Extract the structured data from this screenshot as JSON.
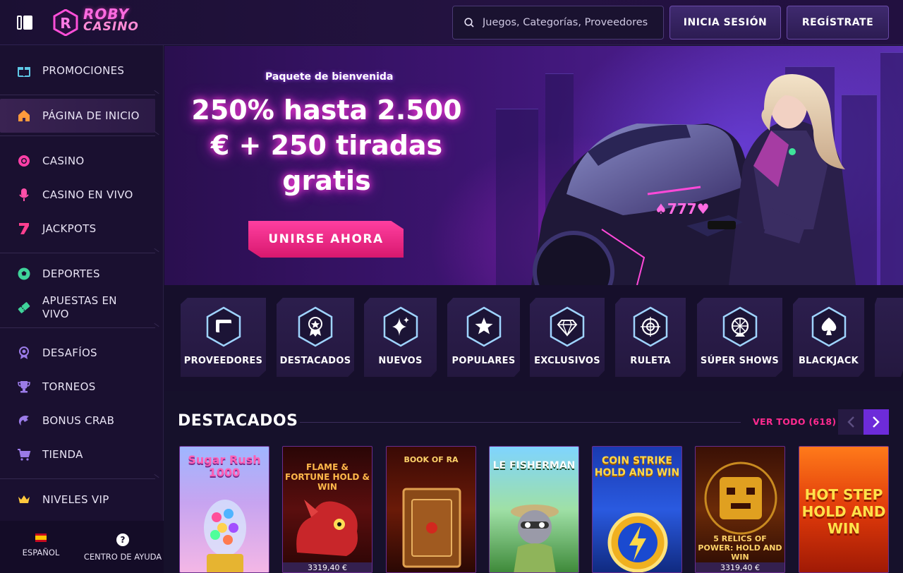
{
  "header": {
    "logo_line1": "ROBY",
    "logo_line2": "CASINO",
    "search_placeholder": "Juegos, Categorías, Proveedores",
    "login_label": "INICIA SESIÓN",
    "register_label": "REGÍSTRATE"
  },
  "sidebar": {
    "items": [
      {
        "label": "PROMOCIONES",
        "icon": "gift-icon"
      },
      {
        "label": "PÁGINA DE INICIO",
        "icon": "home-icon"
      },
      {
        "label": "CASINO",
        "icon": "casino-chip-icon"
      },
      {
        "label": "CASINO EN VIVO",
        "icon": "microphone-icon"
      },
      {
        "label": "JACKPOTS",
        "icon": "seven-icon"
      },
      {
        "label": "DEPORTES",
        "icon": "soccer-ball-icon"
      },
      {
        "label": "APUESTAS EN VIVO",
        "icon": "ticket-icon"
      },
      {
        "label": "DESAFÍOS",
        "icon": "medal-icon"
      },
      {
        "label": "TORNEOS",
        "icon": "trophy-icon"
      },
      {
        "label": "BONUS CRAB",
        "icon": "crab-claw-icon"
      },
      {
        "label": "TIENDA",
        "icon": "cart-icon"
      },
      {
        "label": "NIVELES VIP",
        "icon": "crown-icon"
      }
    ],
    "footer": {
      "language_label": "ESPAÑOL",
      "help_label": "CENTRO DE AYUDA",
      "help_glyph": "?"
    }
  },
  "hero": {
    "subtitle": "Paquete de bienvenida",
    "title": "250% hasta 2.500 € + 250 tiradas gratis",
    "cta_label": "UNIRSE AHORA",
    "bike_plate": "♠777♥"
  },
  "categories": [
    {
      "label": "PROVEEDORES",
      "icon": "folder-icon"
    },
    {
      "label": "DESTACADOS",
      "icon": "award-icon"
    },
    {
      "label": "NUEVOS",
      "icon": "sparkle-icon"
    },
    {
      "label": "POPULARES",
      "icon": "star-icon"
    },
    {
      "label": "EXCLUSIVOS",
      "icon": "diamond-icon"
    },
    {
      "label": "RULETA",
      "icon": "roulette-icon"
    },
    {
      "label": "SÚPER SHOWS",
      "icon": "wheel-icon"
    },
    {
      "label": "BLACKJACK",
      "icon": "spade-icon"
    }
  ],
  "featured": {
    "title": "DESTACADOS",
    "see_all": "VER TODO (618)",
    "games": [
      {
        "title": "Sugar Rush 1000",
        "jackpot": ""
      },
      {
        "title": "FLAME & FORTUNE HOLD & WIN",
        "jackpot": "3319,40 €"
      },
      {
        "title": "BOOK OF RA",
        "jackpot": ""
      },
      {
        "title": "LE FISHERMAN",
        "jackpot": ""
      },
      {
        "title": "COIN STRIKE HOLD AND WIN",
        "jackpot": ""
      },
      {
        "title": "5 RELICS OF POWER: HOLD AND WIN",
        "jackpot": "3319,40 €"
      },
      {
        "title": "HOT STEP HOLD AND WIN",
        "jackpot": ""
      }
    ]
  },
  "colors": {
    "accent_pink": "#ff2a8f",
    "accent_purple": "#6d2bd9",
    "bg": "#16112b"
  }
}
